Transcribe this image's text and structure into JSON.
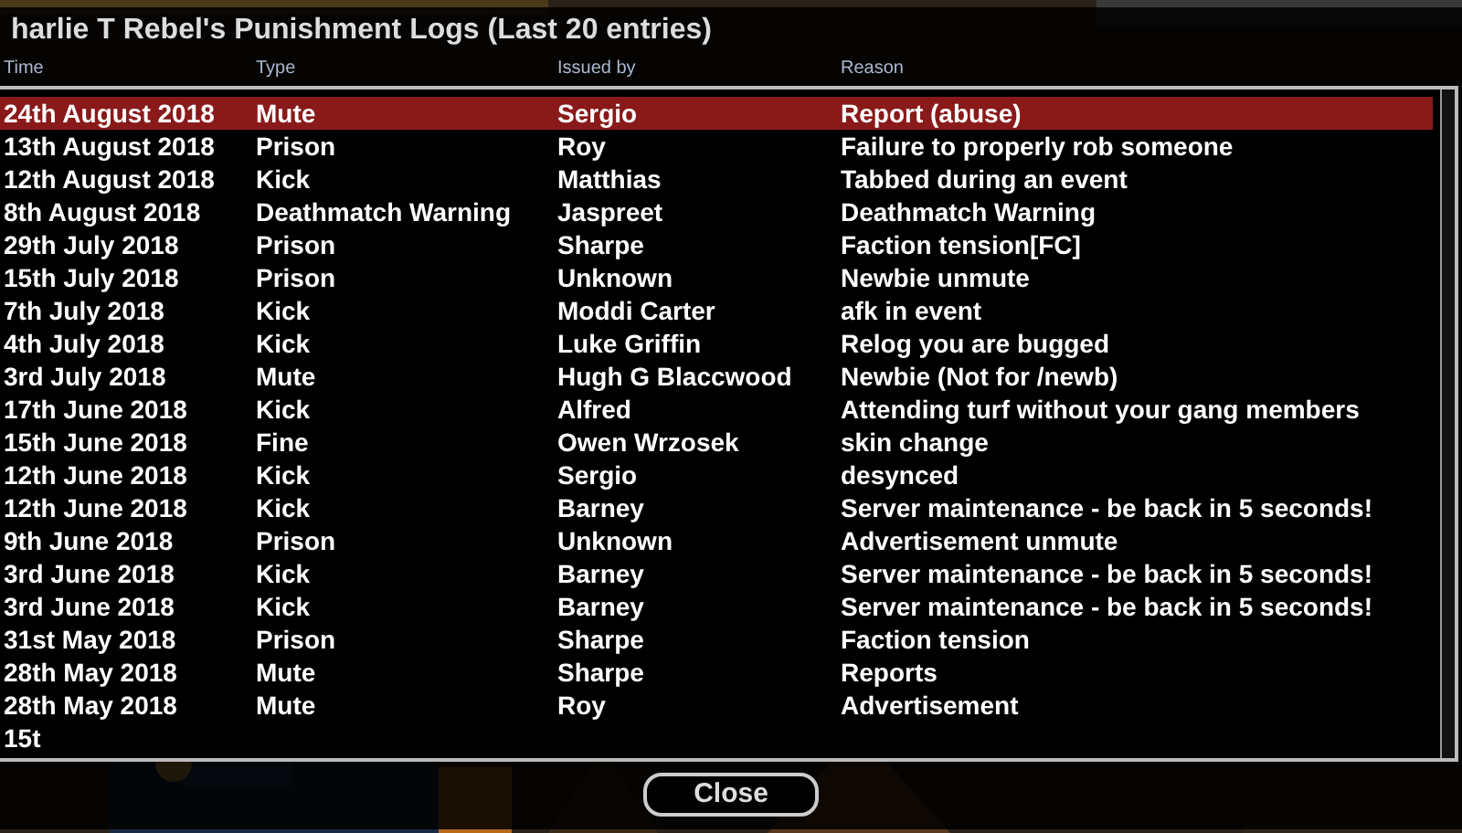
{
  "dialog": {
    "title": "harlie T Rebel's Punishment Logs (Last 20 entries)",
    "columns": [
      "Time",
      "Type",
      "Issued by",
      "Reason"
    ],
    "rows": [
      {
        "cells": [
          "24th August 2018",
          "Mute",
          "Sergio",
          "Report (abuse)"
        ],
        "selected": true
      },
      {
        "cells": [
          "13th August 2018",
          "Prison",
          "Roy",
          "Failure to properly rob someone"
        ],
        "selected": false
      },
      {
        "cells": [
          "12th August 2018",
          "Kick",
          "Matthias",
          "Tabbed during an event"
        ],
        "selected": false
      },
      {
        "cells": [
          "8th August 2018",
          "Deathmatch Warning",
          "Jaspreet",
          "Deathmatch Warning"
        ],
        "selected": false
      },
      {
        "cells": [
          "29th July 2018",
          "Prison",
          "Sharpe",
          "Faction tension[FC]"
        ],
        "selected": false
      },
      {
        "cells": [
          "15th July 2018",
          "Prison",
          "Unknown",
          "Newbie unmute"
        ],
        "selected": false
      },
      {
        "cells": [
          "7th July 2018",
          "Kick",
          "Moddi Carter",
          "afk in event"
        ],
        "selected": false
      },
      {
        "cells": [
          "4th July 2018",
          "Kick",
          "Luke Griffin",
          "Relog you are bugged"
        ],
        "selected": false
      },
      {
        "cells": [
          "3rd July 2018",
          "Mute",
          "Hugh G Blaccwood",
          "Newbie (Not for /newb)"
        ],
        "selected": false
      },
      {
        "cells": [
          "17th June 2018",
          "Kick",
          "Alfred",
          "Attending turf without your gang members"
        ],
        "selected": false
      },
      {
        "cells": [
          "15th June 2018",
          "Fine",
          "Owen Wrzosek",
          "skin change"
        ],
        "selected": false
      },
      {
        "cells": [
          "12th June 2018",
          "Kick",
          "Sergio",
          "desynced"
        ],
        "selected": false
      },
      {
        "cells": [
          "12th June 2018",
          "Kick",
          "Barney",
          "Server maintenance - be back in 5 seconds!"
        ],
        "selected": false
      },
      {
        "cells": [
          "9th June 2018",
          "Prison",
          "Unknown",
          "Advertisement unmute"
        ],
        "selected": false
      },
      {
        "cells": [
          "3rd June 2018",
          "Kick",
          "Barney",
          "Server maintenance - be back in 5 seconds!"
        ],
        "selected": false
      },
      {
        "cells": [
          "3rd June 2018",
          "Kick",
          "Barney",
          "Server maintenance - be back in 5 seconds!"
        ],
        "selected": false
      },
      {
        "cells": [
          "31st May 2018",
          "Prison",
          "Sharpe",
          "Faction tension"
        ],
        "selected": false
      },
      {
        "cells": [
          "28th May 2018",
          "Mute",
          "Sharpe",
          "Reports"
        ],
        "selected": false
      },
      {
        "cells": [
          "28th May 2018",
          "Mute",
          "Roy",
          "Advertisement"
        ],
        "selected": false
      },
      {
        "cells": [
          "15t"
        ],
        "selected": false
      }
    ],
    "button": "Close"
  }
}
